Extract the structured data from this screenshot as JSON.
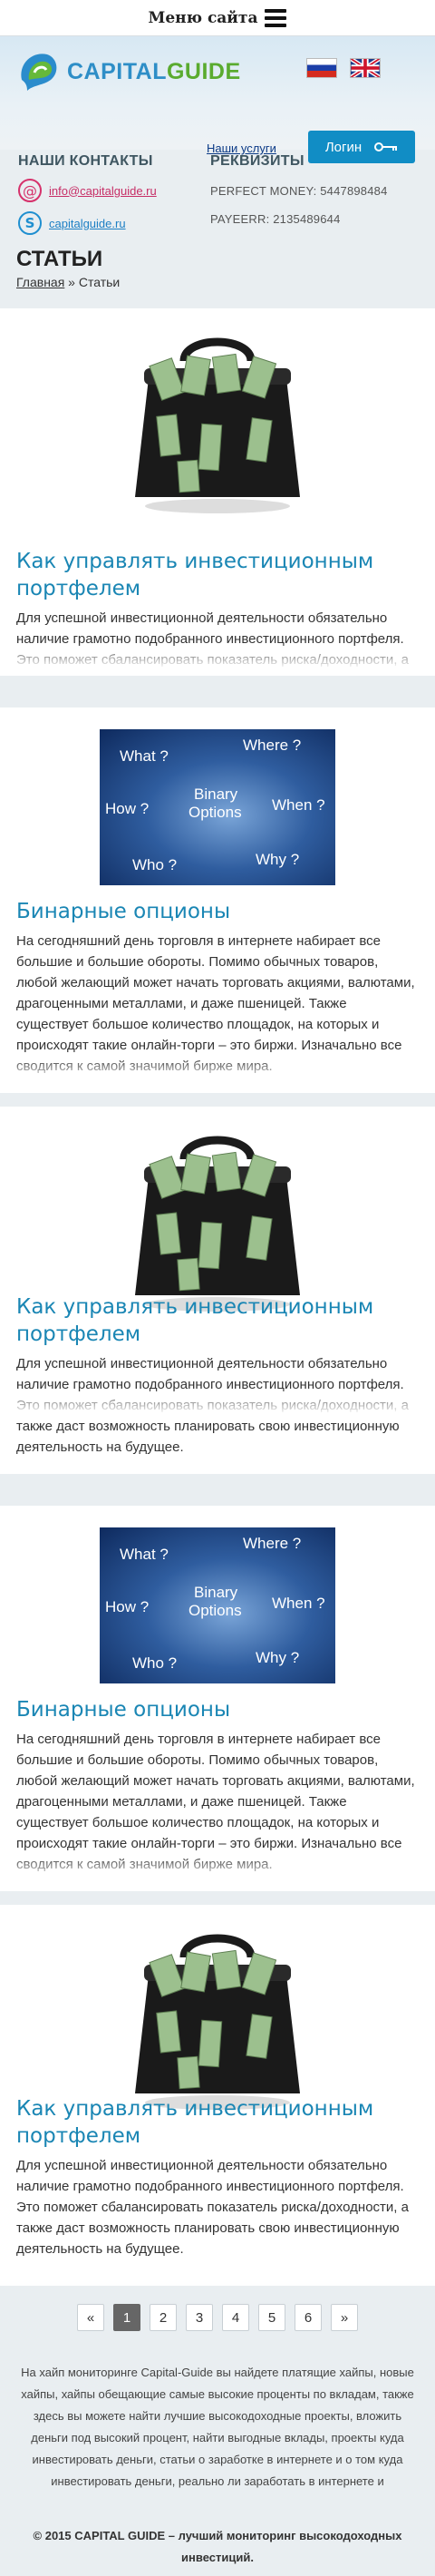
{
  "top_menu": {
    "label": "Меню сайта"
  },
  "header": {
    "logo_part1": "CAPITAL",
    "logo_part2": "GUIDE",
    "services_link": "Наши услуги",
    "login_label": "Логин"
  },
  "contacts": {
    "title": "НАШИ КОНТАКТЫ",
    "email": "info@capitalguide.ru",
    "skype": "capitalguide.ru"
  },
  "requisites": {
    "title": "РЕКВИЗИТЫ",
    "perfect_money": "PERFECT MONEY: 5447898484",
    "payeer": "PAYEERR: 2135489644"
  },
  "page": {
    "title": "СТАТЬИ",
    "breadcrumb_home": "Главная",
    "breadcrumb_sep": " » ",
    "breadcrumb_current": "Статьи"
  },
  "articles": [
    {
      "title": "Как управлять инвестиционным портфелем",
      "text": "Для успешной инвестиционной деятельности обязательно наличие грамотно подобранного инвестиционного портфеля. Это поможет сбалансировать показатель риска/доходности, а также даст возможность планировать свою инвестиционную деятельность на будущее.",
      "image": "money-bag-image"
    },
    {
      "title": "Бинарные опционы",
      "text": "На сегодняшний день торговля в интернете набирает все большие и большие обороты. Помимо обычных товаров, любой желающий может начать торговать акциями, валютами, драгоценными металлами, и даже пшеницей. Также существует большое количество площадок, на которых и происходят такие онлайн-торги – это биржи. Изначально все сводится к самой значимой бирже мира.",
      "image": "binary-options-image"
    },
    {
      "title": "Как управлять инвестиционным портфелем",
      "text": "Для успешной инвестиционной деятельности обязательно наличие грамотно подобранного инвестиционного портфеля. Это поможет сбалансировать показатель риска/доходности, а также даст возможность планировать свою инвестиционную деятельность на будущее.",
      "image": "money-bag-image"
    },
    {
      "title": "Бинарные опционы",
      "text": "На сегодняшний день торговля в интернете набирает все большие и большие обороты. Помимо обычных товаров, любой желающий может начать торговать акциями, валютами, драгоценными металлами, и даже пшеницей. Также существует большое количество площадок, на которых и происходят такие онлайн-торги – это биржи. Изначально все сводится к самой значимой бирже мира.",
      "image": "binary-options-image"
    },
    {
      "title": "Как управлять инвестиционным портфелем",
      "text": "Для успешной инвестиционной деятельности обязательно наличие грамотно подобранного инвестиционного портфеля. Это поможет сбалансировать показатель риска/доходности, а также даст возможность планировать свою инвестиционную деятельность на будущее.",
      "image": "money-bag-image"
    }
  ],
  "binary_image_words": {
    "what": "What ?",
    "where": "Where ?",
    "how": "How ?",
    "binary": "Binary",
    "options": "Options",
    "when": "When ?",
    "who": "Who ?",
    "why": "Why ?"
  },
  "pagination": {
    "prev": "«",
    "pages": [
      "1",
      "2",
      "3",
      "4",
      "5",
      "6"
    ],
    "next": "»",
    "current": "1"
  },
  "footer": {
    "text": "На хайп мониторинге Capital-Guide вы найдете платящие хайпы, новые хайпы, хайпы обещающие самые высокие проценты по вкладам, также здесь вы можете найти лучшие высокодоходные проекты, вложить деньги под высокий процент, найти выгодные вклады, проекты куда инвестировать деньги, статьи о заработке в интернете и о том куда инвестировать деньги, реально ли заработать в интернете и",
    "copyright": "© 2015 CAPITAL GUIDE – лучший мониторинг высокодоходных инвестиций."
  },
  "colors": {
    "accent": "#118dc5",
    "title_blue": "#1a86b4",
    "logo_green": "#5aab2f",
    "email_pink": "#c72d66"
  }
}
